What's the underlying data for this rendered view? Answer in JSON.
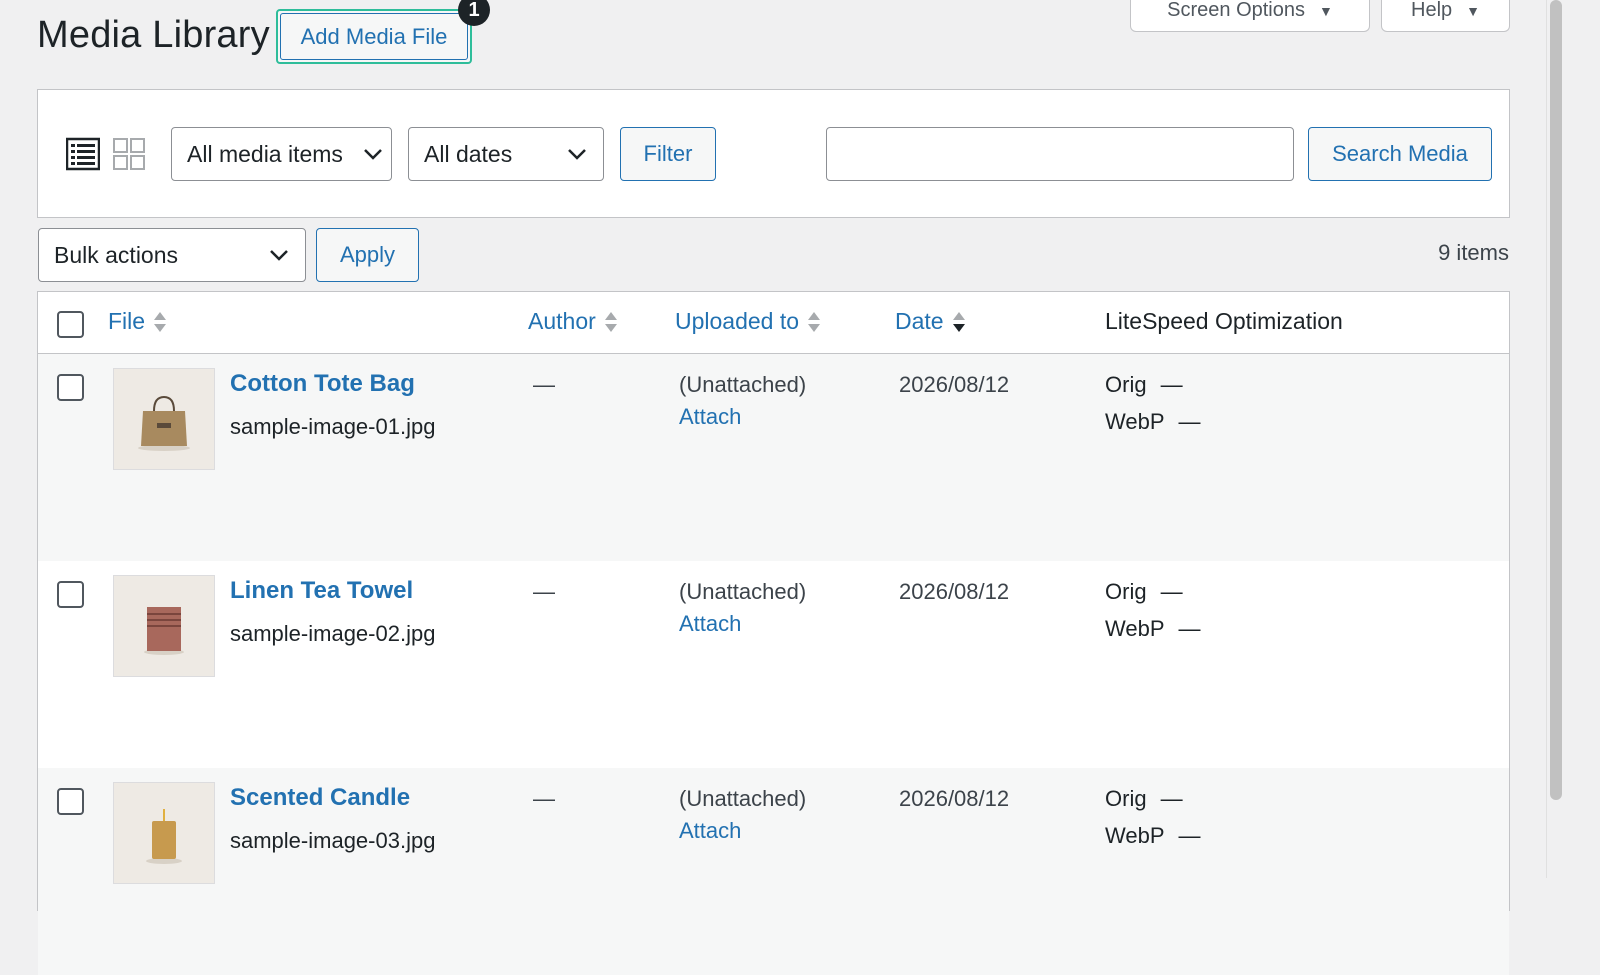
{
  "header": {
    "title": "Media Library",
    "add_button": "Add Media File",
    "step_badge": "1",
    "screen_options": "Screen Options",
    "help": "Help"
  },
  "filters": {
    "type_select": "All media items",
    "date_select": "All dates",
    "filter_button": "Filter",
    "search_value": "",
    "search_button": "Search Media"
  },
  "bulk": {
    "select": "Bulk actions",
    "apply": "Apply",
    "count": "9 items"
  },
  "columns": {
    "file": "File",
    "author": "Author",
    "uploaded_to": "Uploaded to",
    "date": "Date",
    "litespeed": "LiteSpeed Optimization"
  },
  "rows": [
    {
      "title": "Cotton Tote Bag",
      "filename": "sample-image-01.jpg",
      "author": "—",
      "uploaded_to": "(Unattached)",
      "attach": "Attach",
      "date": "2026/08/12",
      "orig_label": "Orig",
      "orig_value": "—",
      "webp_label": "WebP",
      "webp_value": "—",
      "thumb_icon": "tote-bag-icon"
    },
    {
      "title": "Linen Tea Towel",
      "filename": "sample-image-02.jpg",
      "author": "—",
      "uploaded_to": "(Unattached)",
      "attach": "Attach",
      "date": "2026/08/12",
      "orig_label": "Orig",
      "orig_value": "—",
      "webp_label": "WebP",
      "webp_value": "—",
      "thumb_icon": "tea-towel-icon"
    },
    {
      "title": "Scented Candle",
      "filename": "sample-image-03.jpg",
      "author": "—",
      "uploaded_to": "(Unattached)",
      "attach": "Attach",
      "date": "2026/08/12",
      "orig_label": "Orig",
      "orig_value": "—",
      "webp_label": "WebP",
      "webp_value": "—",
      "thumb_icon": "candle-icon"
    }
  ],
  "colors": {
    "accent": "#2271b1",
    "highlight": "#2ebd9a",
    "background": "#f0f0f1"
  }
}
